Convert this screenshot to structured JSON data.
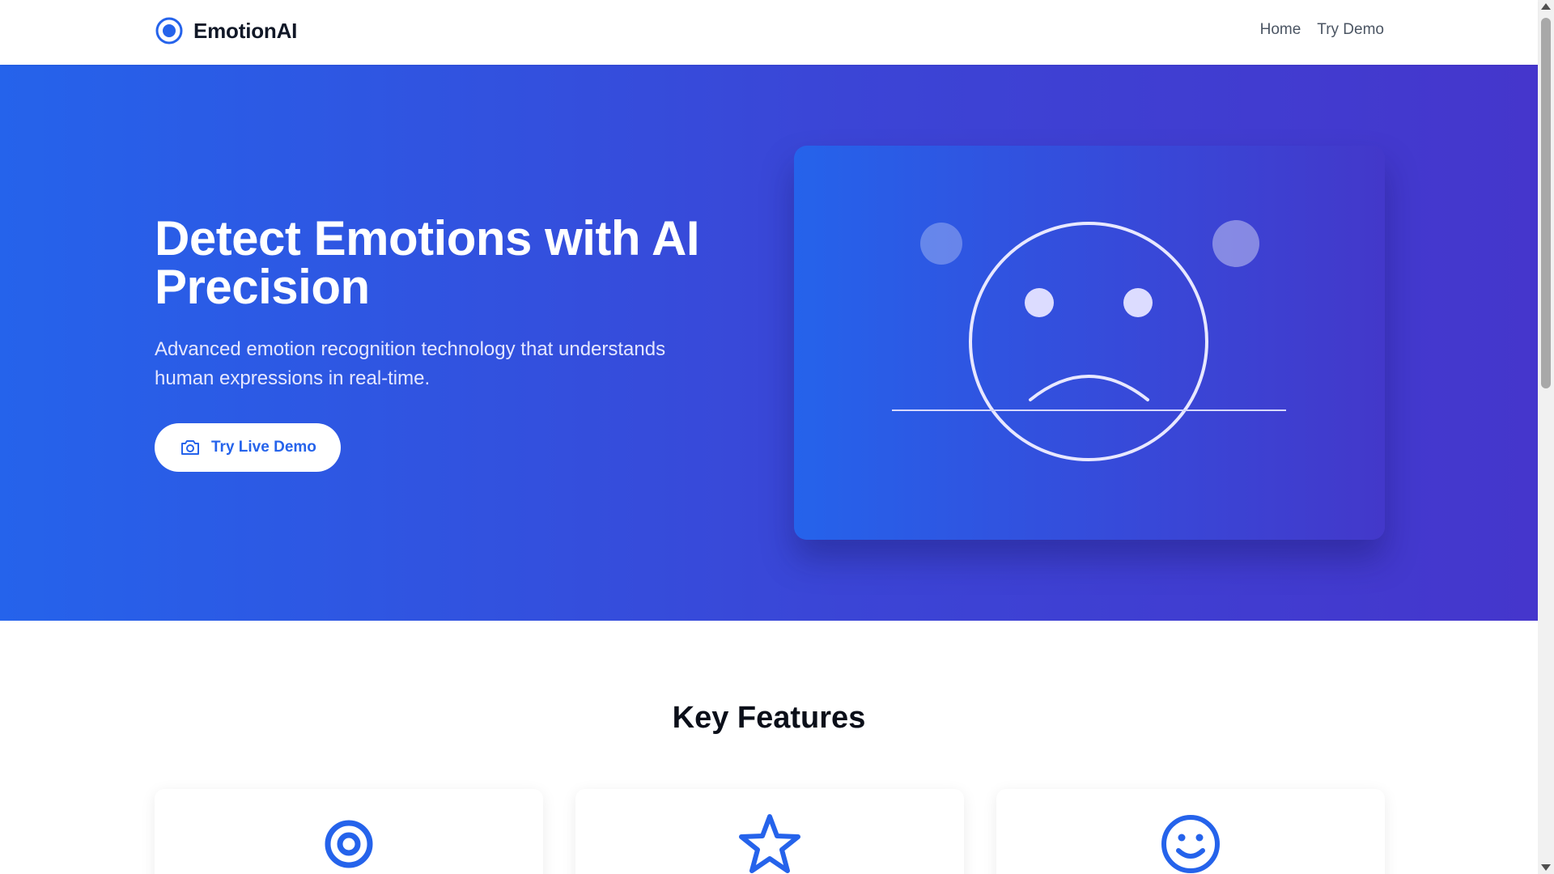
{
  "navbar": {
    "brand_name": "EmotionAI",
    "brand_icon": "target-icon",
    "links": [
      {
        "label": "Home"
      },
      {
        "label": "Try Demo"
      }
    ]
  },
  "hero": {
    "title": "Detect Emotions with AI Precision",
    "subtitle": "Advanced emotion recognition technology that understands human expressions in real-time.",
    "cta_label": "Try Live Demo",
    "cta_icon": "camera-icon",
    "illustration": "sad-face-icon",
    "gradient": [
      "#2563eb",
      "#4338ca"
    ]
  },
  "features": {
    "title": "Key Features",
    "cards": [
      {
        "icon": "target-icon"
      },
      {
        "icon": "star-icon"
      },
      {
        "icon": "smile-icon"
      }
    ]
  },
  "colors": {
    "accent": "#2563eb",
    "accent_dark": "#4338ca",
    "text_dark": "#111827",
    "nav_text": "#4b5563"
  }
}
